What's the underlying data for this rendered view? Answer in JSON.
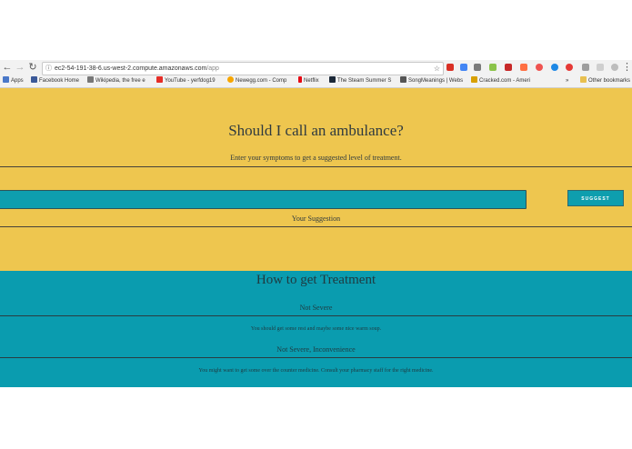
{
  "browser": {
    "url_host": "ec2-54-191-38-6.us-west-2.compute.amazonaws.com",
    "url_path": "/app",
    "info_icon": "info-icon",
    "back_icon": "←",
    "forward_icon": "→",
    "reload_icon": "↻",
    "star_icon": "☆",
    "bookmarks": [
      {
        "label": "Apps",
        "color": "#4a78c8"
      },
      {
        "label": "Facebook Home",
        "color": "#3b5998"
      },
      {
        "label": "Wikipedia, the free e",
        "color": "#777777"
      },
      {
        "label": "YouTube - yerfdog19",
        "color": "#e52d27"
      },
      {
        "label": "Newegg.com - Comp",
        "color": "#f7a600"
      },
      {
        "label": "Netflix",
        "color": "#e50914"
      },
      {
        "label": "The Steam Summer S",
        "color": "#1b2838"
      },
      {
        "label": "SongMeanings | Webs",
        "color": "#555555"
      },
      {
        "label": "Cracked.com - Ameri",
        "color": "#d8a000"
      },
      {
        "label": "Other bookmarks",
        "color": "#e8c050"
      }
    ],
    "overflow_label": "»"
  },
  "hero": {
    "title": "Should I call an ambulance?",
    "subtitle": "Enter your symptoms to get a suggested level of treatment.",
    "input_value": "",
    "suggest_label": "SUGGEST",
    "suggestion_label": "Your Suggestion",
    "bg_color": "#eec64f"
  },
  "treatment": {
    "title": "How to get Treatment",
    "bg_color": "#0a9caf",
    "levels": [
      {
        "name": "Not Severe",
        "description": "You should get some rest and maybe some nice warm soup."
      },
      {
        "name": "Not Severe, Inconvenience",
        "description": "You might want to get some over the counter medicine. Consult your pharmacy staff for the right medicine."
      }
    ]
  }
}
